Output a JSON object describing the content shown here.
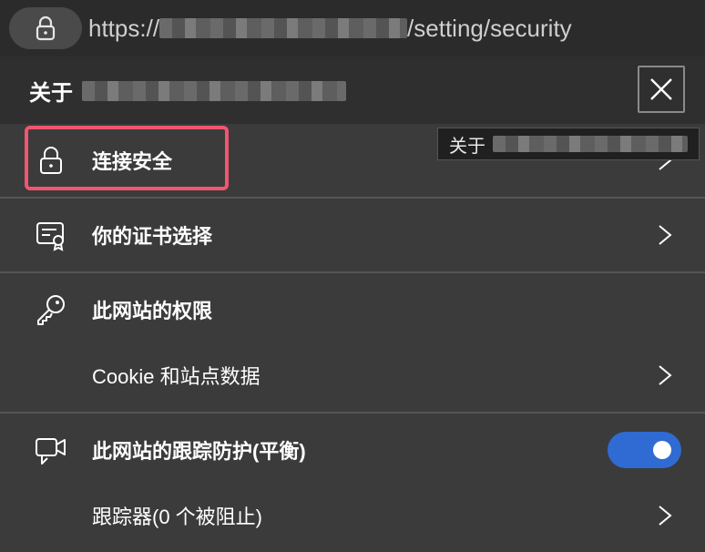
{
  "address_bar": {
    "url_prefix": "https://",
    "url_suffix": "/setting/security"
  },
  "panel": {
    "title": "关于",
    "close_label": "Close"
  },
  "tooltip": {
    "text": "关于"
  },
  "items": [
    {
      "label": "连接安全",
      "icon": "lock-icon",
      "has_chevron": true,
      "focused": true
    },
    {
      "label": "你的证书选择",
      "icon": "certificate-icon",
      "has_chevron": true
    },
    {
      "label": "此网站的权限",
      "icon": "key-icon",
      "has_chevron": false
    },
    {
      "label": "Cookie 和站点数据",
      "icon": "",
      "has_chevron": true
    },
    {
      "label": "此网站的跟踪防护(平衡)",
      "icon": "tracking-prevention-icon",
      "has_chevron": false,
      "toggle_on": true
    },
    {
      "label": "跟踪器(0 个被阻止)",
      "icon": "",
      "has_chevron": true
    }
  ],
  "colors": {
    "focus_ring": "#f0566f",
    "toggle_on": "#2f6bd2",
    "panel_bg": "#3b3b3b"
  }
}
